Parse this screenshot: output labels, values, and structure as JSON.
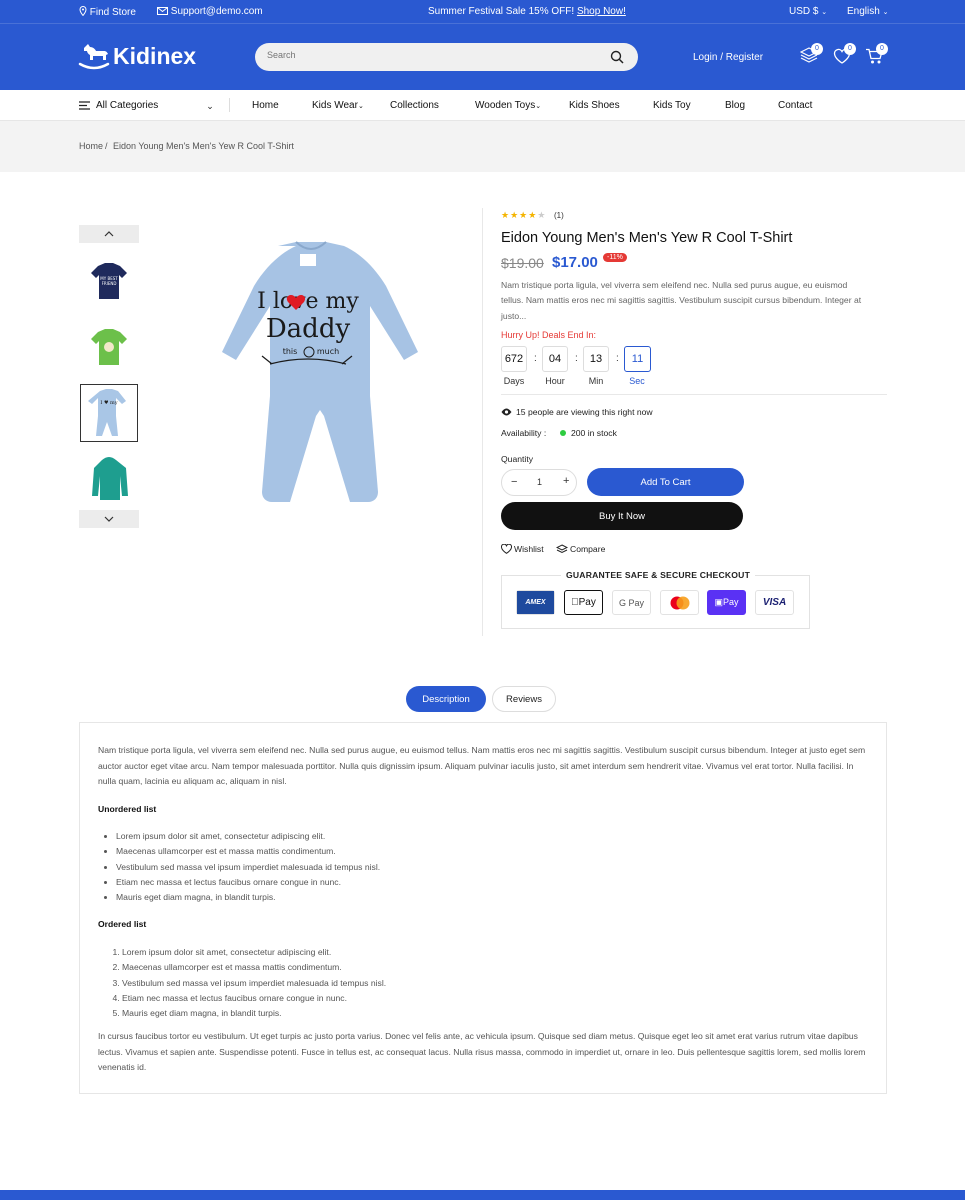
{
  "topbar": {
    "find_store": "Find Store",
    "support": "Support@demo.com",
    "promo_text": "Summer Festival Sale 15% OFF!",
    "promo_link": "Shop Now!",
    "currency": "USD $",
    "language": "English"
  },
  "header": {
    "logo": "Kidinex",
    "search_placeholder": "Search",
    "login": "Login / Register",
    "compare_count": "0",
    "wishlist_count": "0",
    "cart_count": "0"
  },
  "nav": {
    "all_categories": "All Categories",
    "items": [
      "Home",
      "Kids Wear",
      "Collections",
      "Wooden Toys",
      "Kids Shoes",
      "Kids Toy",
      "Blog",
      "Contact"
    ]
  },
  "breadcrumb": {
    "home": "Home",
    "sep": "/",
    "current": "Eidon Young Men's Men's Yew R Cool T-Shirt"
  },
  "product": {
    "rating": 4,
    "review_count": "(1)",
    "title": "Eidon Young Men's Men's Yew R Cool T-Shirt",
    "old_price": "$19.00",
    "price": "$17.00",
    "discount": "-11%",
    "short_desc": "Nam tristique porta ligula, vel viverra sem eleifend nec. Nulla sed purus augue, eu euismod tellus. Nam mattis eros nec mi sagittis sagittis. Vestibulum suscipit cursus bibendum. Integer at justo...",
    "hurry": "Hurry Up! Deals End In:",
    "countdown": {
      "days": "672",
      "hours": "04",
      "mins": "13",
      "secs": "11"
    },
    "countdown_labels": {
      "days": "Days",
      "hours": "Hour",
      "mins": "Min",
      "secs": "Sec"
    },
    "viewing": "15 people are viewing this right now",
    "availability_label": "Availability :",
    "availability_value": "200 in stock",
    "quantity_label": "Quantity",
    "quantity": "1",
    "add_to_cart": "Add To Cart",
    "buy_now": "Buy It Now",
    "wishlist": "Wishlist",
    "compare": "Compare",
    "guarantee": "GUARANTEE SAFE & SECURE CHECKOUT",
    "payments": [
      "AMEX",
      "Pay",
      "G Pay",
      "Mastercard",
      "Pay",
      "VISA"
    ]
  },
  "artwork": {
    "line1": "I love my",
    "line2": "Daddy",
    "line3a": "this",
    "line3b": "much"
  },
  "tabs": {
    "description": "Description",
    "reviews": "Reviews"
  },
  "description": {
    "intro": "Nam tristique porta ligula, vel viverra sem eleifend nec. Nulla sed purus augue, eu euismod tellus. Nam mattis eros nec mi sagittis sagittis. Vestibulum suscipit cursus bibendum. Integer at justo eget sem auctor auctor eget vitae arcu. Nam tempor malesuada porttitor. Nulla quis dignissim ipsum. Aliquam pulvinar iaculis justo, sit amet interdum sem hendrerit vitae. Vivamus vel erat tortor. Nulla facilisi. In nulla quam, lacinia eu aliquam ac, aliquam in nisl.",
    "unordered_heading": "Unordered list",
    "unordered": [
      "Lorem ipsum dolor sit amet, consectetur adipiscing elit.",
      "Maecenas ullamcorper est et massa mattis condimentum.",
      "Vestibulum sed massa vel ipsum imperdiet malesuada id tempus nisl.",
      "Etiam nec massa et lectus faucibus ornare congue in nunc.",
      "Mauris eget diam magna, in blandit turpis."
    ],
    "ordered_heading": "Ordered list",
    "ordered": [
      "Lorem ipsum dolor sit amet, consectetur adipiscing elit.",
      "Maecenas ullamcorper est et massa mattis condimentum.",
      "Vestibulum sed massa vel ipsum imperdiet malesuada id tempus nisl.",
      "Etiam nec massa et lectus faucibus ornare congue in nunc.",
      "Mauris eget diam magna, in blandit turpis."
    ],
    "outro": "In cursus faucibus tortor eu vestibulum. Ut eget turpis ac justo porta varius. Donec vel felis ante, ac vehicula ipsum. Quisque sed diam metus. Quisque eget leo sit amet erat varius rutrum vitae dapibus lectus. Vivamus et sapien ante. Suspendisse potenti. Fusce in tellus est, ac consequat lacus. Nulla risus massa, commodo in imperdiet ut, ornare in leo. Duis pellentesque sagittis lorem, sed mollis lorem venenatis id."
  },
  "colors": {
    "brand": "#2a59d1",
    "sale": "#e53935",
    "star": "#f4b400",
    "in_stock": "#2ecc40"
  }
}
